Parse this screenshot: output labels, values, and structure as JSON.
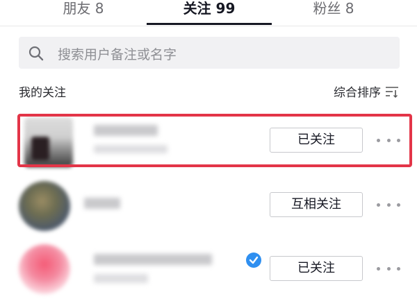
{
  "tabs": [
    {
      "label": "朋友 8"
    },
    {
      "label": "关注 99"
    },
    {
      "label": "粉丝 8"
    }
  ],
  "active_tab": 1,
  "search": {
    "placeholder": "搜索用户备注或名字"
  },
  "section": {
    "title": "我的关注",
    "sort_label": "综合排序"
  },
  "follows": [
    {
      "button_label": "已关注",
      "highlighted": true,
      "verified": false
    },
    {
      "button_label": "互相关注",
      "highlighted": false,
      "verified": false
    },
    {
      "button_label": "已关注",
      "highlighted": false,
      "verified": true
    }
  ],
  "colors": {
    "highlight": "#e33548",
    "verified": "#2f8ff0",
    "text": "#161823",
    "muted": "#8e8f94"
  },
  "icons": {
    "search": "search-icon",
    "sort": "sort-icon",
    "more": "more-dots-icon",
    "verified": "verified-badge-icon"
  }
}
